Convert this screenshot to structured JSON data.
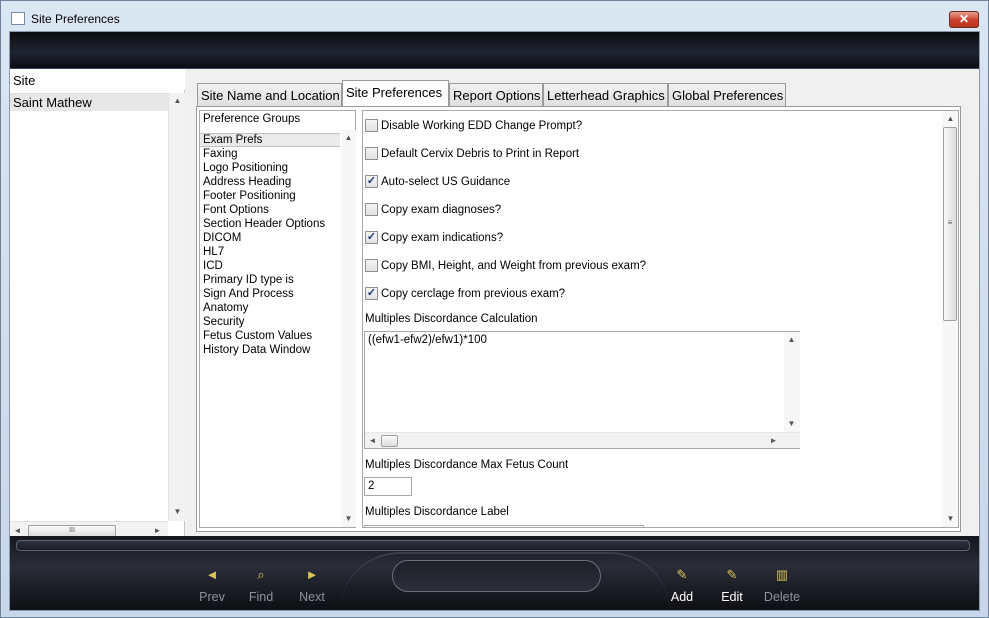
{
  "window": {
    "title": "Site Preferences",
    "close_glyph": "✕"
  },
  "left_panel": {
    "header": "Site",
    "items": [
      "Saint Mathew"
    ],
    "scroll_up": "▲",
    "scroll_down": "▼",
    "scroll_left": "◄",
    "scroll_right": "►",
    "thumb_grip": "III"
  },
  "tabs": [
    "Site Name and Location",
    "Site Preferences",
    "Report Options",
    "Letterhead Graphics",
    "Global Preferences"
  ],
  "active_tab": "Site Preferences",
  "preference_groups": {
    "header": "Preference Groups",
    "items": [
      "Exam Prefs",
      "Faxing",
      "Logo Positioning",
      "Address Heading",
      "Footer Positioning",
      "Font Options",
      "Section Header Options",
      "DICOM",
      "HL7",
      "ICD",
      "Primary ID type is",
      "Sign And Process",
      "Anatomy",
      "Security",
      "Fetus Custom Values",
      "History Data Window"
    ],
    "selected": "Exam Prefs"
  },
  "preferences": {
    "checkboxes": [
      {
        "label": "Disable Working EDD Change Prompt?",
        "checked": false
      },
      {
        "label": "Default Cervix Debris to Print in Report",
        "checked": false
      },
      {
        "label": "Auto-select US Guidance",
        "checked": true
      },
      {
        "label": "Copy exam diagnoses?",
        "checked": false
      },
      {
        "label": "Copy exam indications?",
        "checked": true
      },
      {
        "label": "Copy BMI, Height, and Weight from previous exam?",
        "checked": false
      },
      {
        "label": "Copy cerclage from previous exam?",
        "checked": true
      }
    ],
    "check_mark": "✓",
    "discordance_calc_label": "Multiples Discordance Calculation",
    "discordance_calc_value": "((efw1-efw2)/efw1)*100",
    "max_fetus_label": "Multiples Discordance Max Fetus Count",
    "max_fetus_value": "2",
    "discordance_label_label": "Multiples Discordance Label",
    "discordance_label_value": ""
  },
  "toolbar": {
    "prev": {
      "label": "Prev",
      "icon": "◄"
    },
    "find": {
      "label": "Find",
      "icon": "⌕"
    },
    "next": {
      "label": "Next",
      "icon": "►"
    },
    "add": {
      "label": "Add",
      "icon": "✎"
    },
    "edit": {
      "label": "Edit",
      "icon": "✎"
    },
    "delete": {
      "label": "Delete",
      "icon": "▥"
    }
  }
}
